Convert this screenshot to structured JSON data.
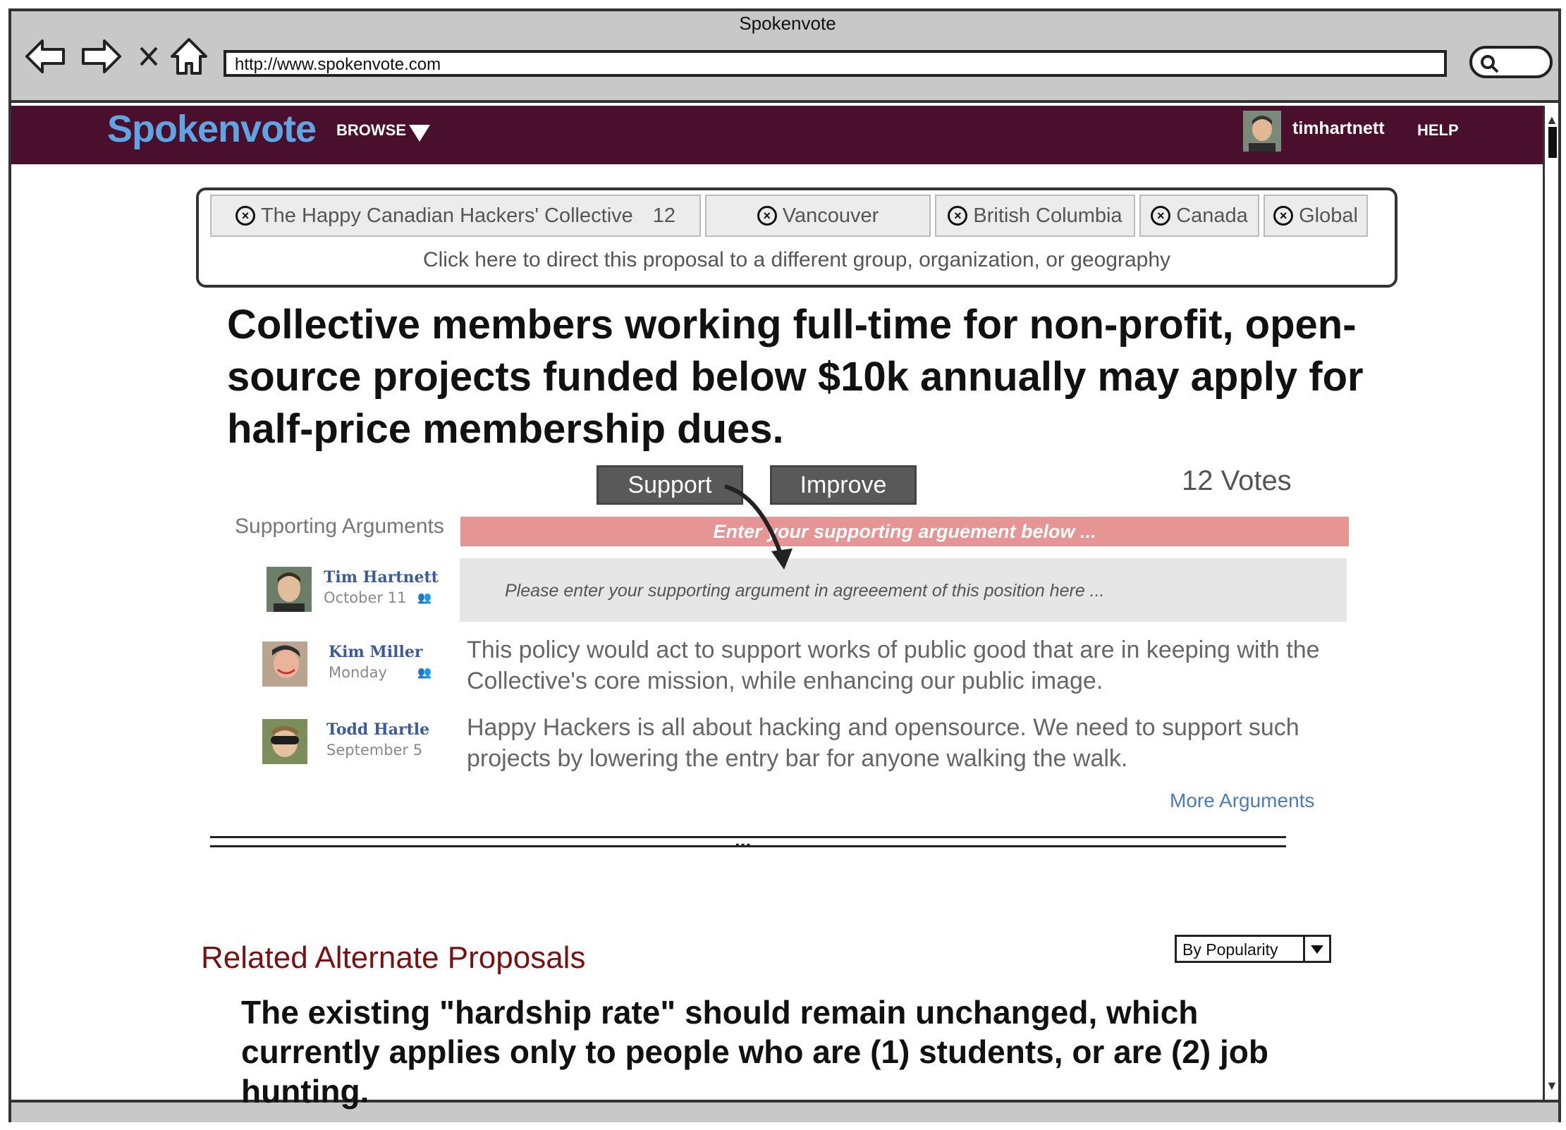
{
  "window": {
    "title": "Spokenvote",
    "url": "http://www.spokenvote.com"
  },
  "site": {
    "logo": "Spokenvote",
    "browse_label": "BROWSE",
    "username": "timhartnett",
    "help_label": "HELP"
  },
  "targets": {
    "chips": [
      {
        "label": "The Happy Canadian Hackers' Collective",
        "count": "12"
      },
      {
        "label": "Vancouver"
      },
      {
        "label": "British Columbia"
      },
      {
        "label": "Canada"
      },
      {
        "label": "Global"
      }
    ],
    "hint": "Click here to direct this proposal to a different group, organization, or geography"
  },
  "proposal": {
    "text": "Collective members working full-time for non-profit, open-source projects funded below $10k annually may apply for half-price membership dues.",
    "support_label": "Support",
    "improve_label": "Improve",
    "votes": "12 Votes"
  },
  "arguments": {
    "section_label": "Supporting Arguments",
    "bar_text": "Enter your supporting arguement below ...",
    "input_placeholder": "Please enter your supporting argument in agreeement of this position here ...",
    "items": [
      {
        "name": "Tim Hartnett",
        "date": "October 11",
        "text": ""
      },
      {
        "name": "Kim Miller",
        "date": "Monday",
        "text": "This policy would act to support works of public good that are in keeping with the Collective's core mission, while enhancing our public image."
      },
      {
        "name": "Todd Hartle",
        "date": "September 5",
        "text": "Happy Hackers is all about hacking and opensource. We need to support such projects by lowering the entry bar for anyone walking the walk."
      }
    ],
    "more_label": "More Arguments"
  },
  "divider_label": "...",
  "related": {
    "title": "Related Alternate Proposals",
    "sort_value": "By Popularity",
    "items": [
      {
        "text": "The existing \"hardship rate\" should remain unchanged, which currently applies only to people who are (1) students, or are (2) job hunting."
      }
    ]
  },
  "colors": {
    "header_bg": "#4a0f2c",
    "logo": "#5ea6e3",
    "arg_bar": "#e79494",
    "related_title": "#7a1010",
    "link": "#4d7bb3"
  }
}
